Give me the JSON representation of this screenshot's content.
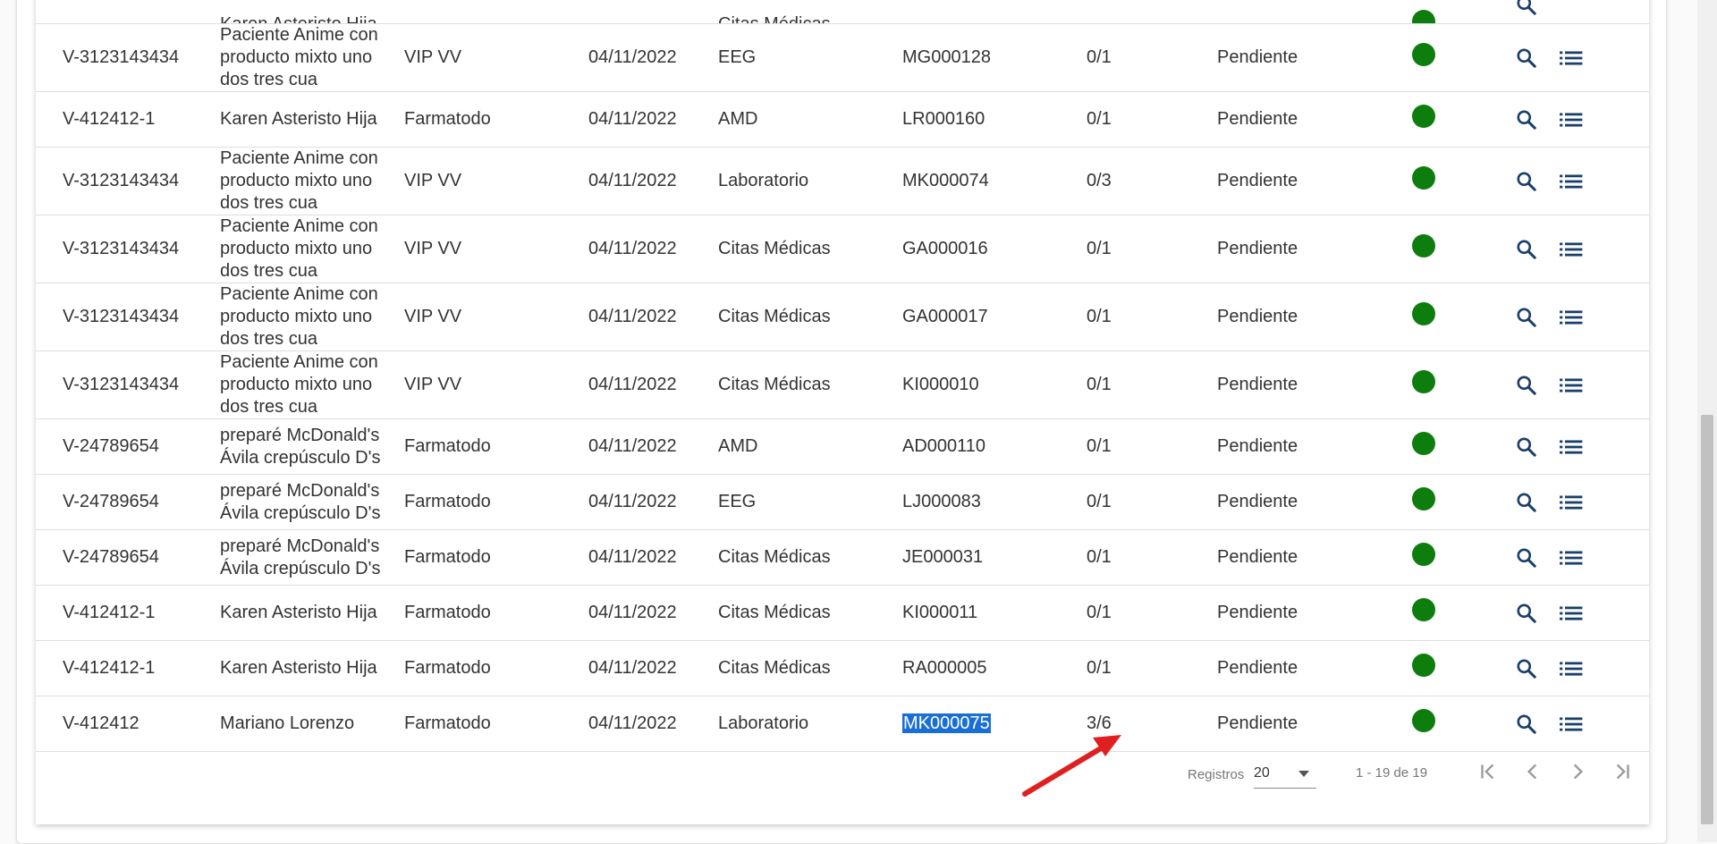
{
  "top_partial": {
    "row_fragment": "Karen Asteristo Hija",
    "area_fragment": "Citas Médicas"
  },
  "rows": [
    {
      "id": "V-3123143434",
      "name": "Paciente Anime con producto mixto uno dos tres cua",
      "company": "VIP VV",
      "date": "04/11/2022",
      "area": "EEG",
      "code": "MG000128",
      "progress": "0/1",
      "status": "Pendiente"
    },
    {
      "id": "V-412412-1",
      "name": "Karen Asteristo Hija",
      "company": "Farmatodo",
      "date": "04/11/2022",
      "area": "AMD",
      "code": "LR000160",
      "progress": "0/1",
      "status": "Pendiente"
    },
    {
      "id": "V-3123143434",
      "name": "Paciente Anime con producto mixto uno dos tres cua",
      "company": "VIP VV",
      "date": "04/11/2022",
      "area": "Laboratorio",
      "code": "MK000074",
      "progress": "0/3",
      "status": "Pendiente"
    },
    {
      "id": "V-3123143434",
      "name": "Paciente Anime con producto mixto uno dos tres cua",
      "company": "VIP VV",
      "date": "04/11/2022",
      "area": "Citas Médicas",
      "code": "GA000016",
      "progress": "0/1",
      "status": "Pendiente"
    },
    {
      "id": "V-3123143434",
      "name": "Paciente Anime con producto mixto uno dos tres cua",
      "company": "VIP VV",
      "date": "04/11/2022",
      "area": "Citas Médicas",
      "code": "GA000017",
      "progress": "0/1",
      "status": "Pendiente"
    },
    {
      "id": "V-3123143434",
      "name": "Paciente Anime con producto mixto uno dos tres cua",
      "company": "VIP VV",
      "date": "04/11/2022",
      "area": "Citas Médicas",
      "code": "KI000010",
      "progress": "0/1",
      "status": "Pendiente"
    },
    {
      "id": "V-24789654",
      "name": "preparé McDonald's Ávila crepúsculo D's",
      "company": "Farmatodo",
      "date": "04/11/2022",
      "area": "AMD",
      "code": "AD000110",
      "progress": "0/1",
      "status": "Pendiente"
    },
    {
      "id": "V-24789654",
      "name": "preparé McDonald's Ávila crepúsculo D's",
      "company": "Farmatodo",
      "date": "04/11/2022",
      "area": "EEG",
      "code": "LJ000083",
      "progress": "0/1",
      "status": "Pendiente"
    },
    {
      "id": "V-24789654",
      "name": "preparé McDonald's Ávila crepúsculo D's",
      "company": "Farmatodo",
      "date": "04/11/2022",
      "area": "Citas Médicas",
      "code": "JE000031",
      "progress": "0/1",
      "status": "Pendiente"
    },
    {
      "id": "V-412412-1",
      "name": "Karen Asteristo Hija",
      "company": "Farmatodo",
      "date": "04/11/2022",
      "area": "Citas Médicas",
      "code": "KI000011",
      "progress": "0/1",
      "status": "Pendiente"
    },
    {
      "id": "V-412412-1",
      "name": "Karen Asteristo Hija",
      "company": "Farmatodo",
      "date": "04/11/2022",
      "area": "Citas Médicas",
      "code": "RA000005",
      "progress": "0/1",
      "status": "Pendiente"
    },
    {
      "id": "V-412412",
      "name": "Mariano Lorenzo",
      "company": "Farmatodo",
      "date": "04/11/2022",
      "area": "Laboratorio",
      "code": "MK000075",
      "progress": "3/6",
      "status": "Pendiente",
      "code_selected": true
    }
  ],
  "row_icons": {
    "status": "status-dot-icon",
    "view": "search-icon",
    "detail": "list-icon"
  },
  "colors": {
    "status_dot": "#0d7d0d",
    "selection": "#1a6fd6",
    "annotation_arrow": "#e02020"
  },
  "pagination": {
    "records_label": "Registros",
    "page_size": "20",
    "range_label": "1 - 19 de 19",
    "icons": [
      "first-page-icon",
      "previous-page-icon",
      "next-page-icon",
      "last-page-icon"
    ]
  }
}
